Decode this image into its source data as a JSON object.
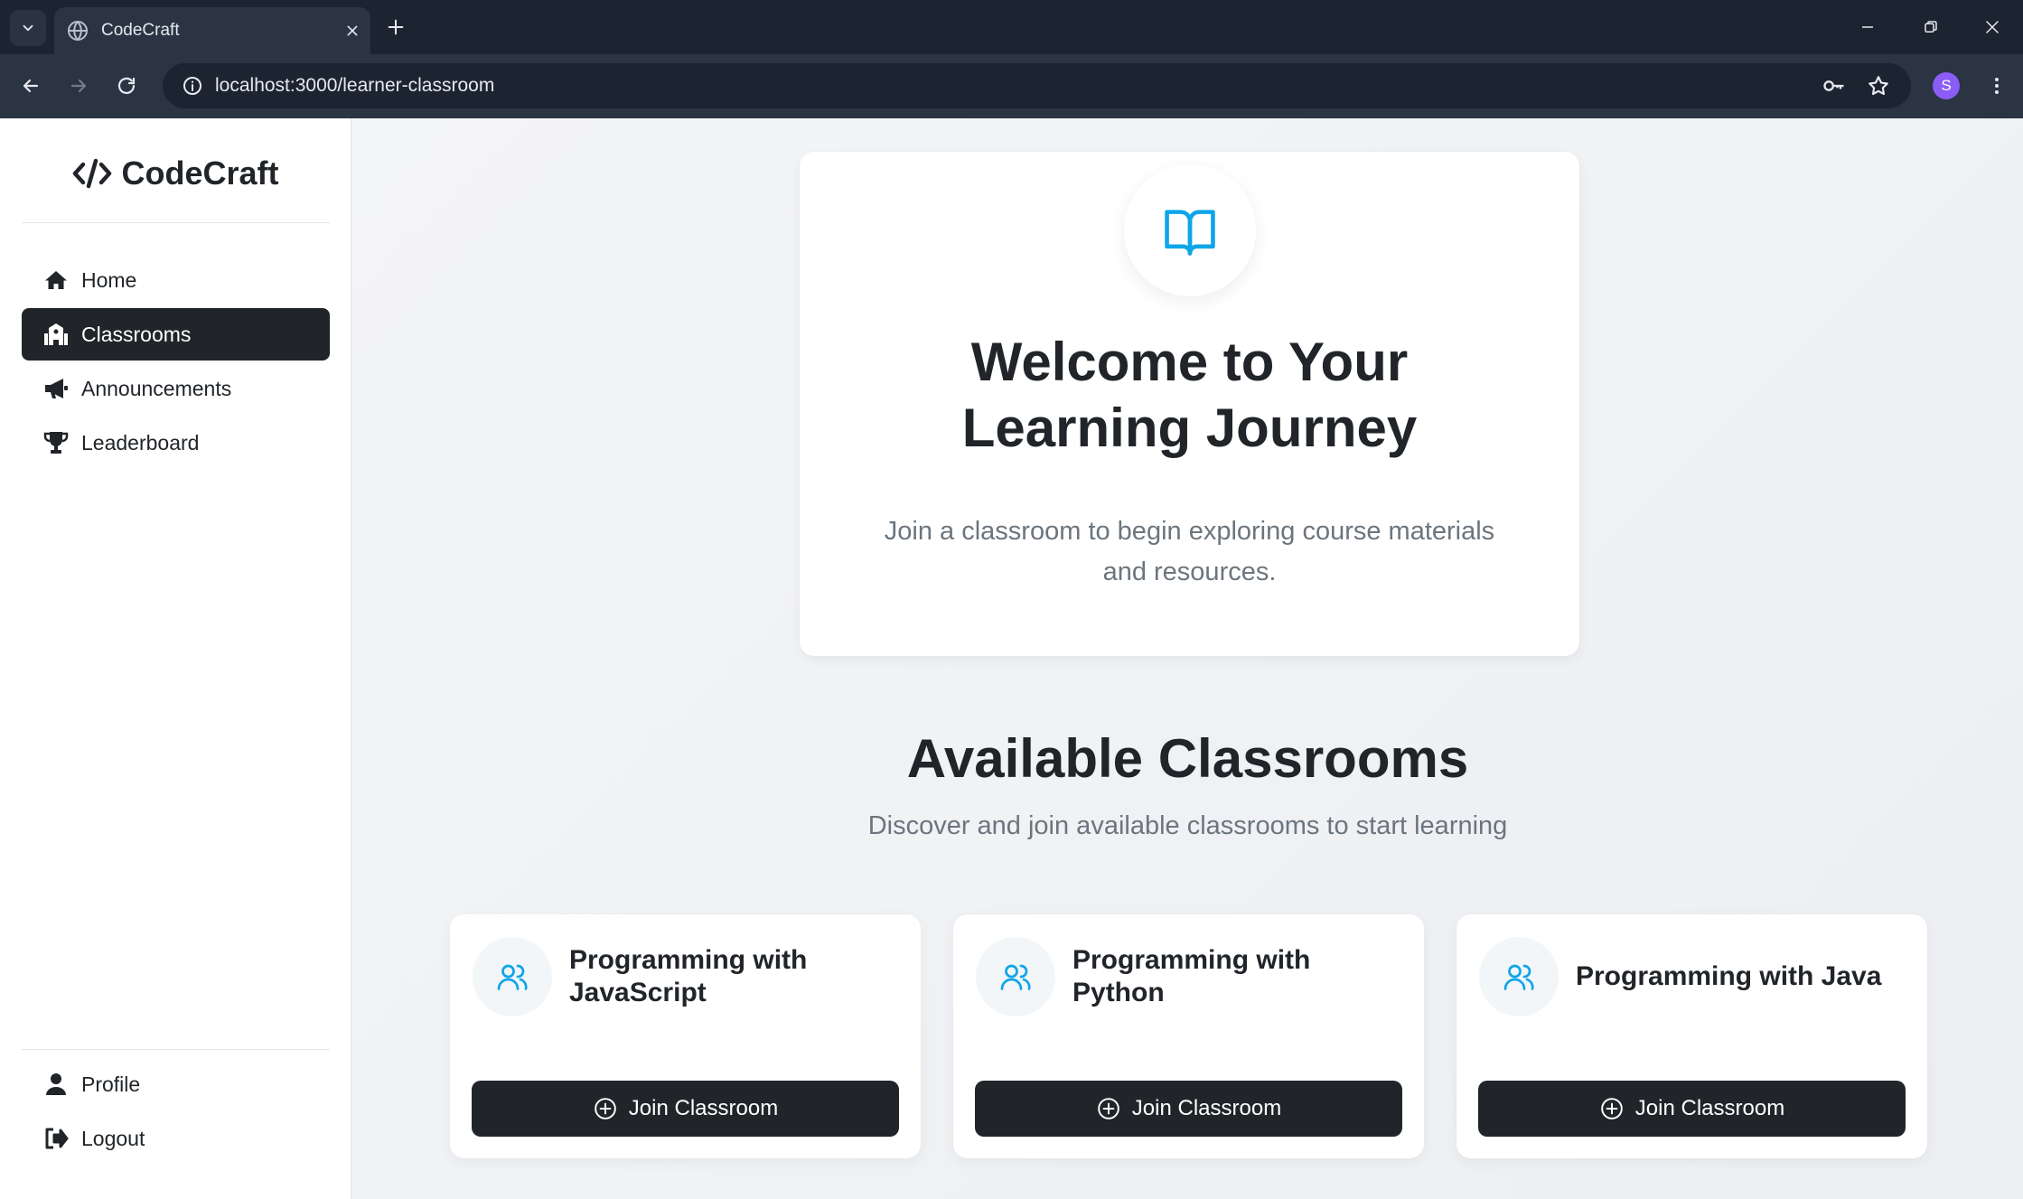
{
  "browser": {
    "tab_title": "CodeCraft",
    "url": "localhost:3000/learner-classroom",
    "profile_initial": "S"
  },
  "sidebar": {
    "brand": "CodeCraft",
    "items": [
      {
        "label": "Home",
        "icon": "home-icon",
        "active": false
      },
      {
        "label": "Classrooms",
        "icon": "school-icon",
        "active": true
      },
      {
        "label": "Announcements",
        "icon": "megaphone-icon",
        "active": false
      },
      {
        "label": "Leaderboard",
        "icon": "trophy-icon",
        "active": false
      }
    ],
    "bottom_items": [
      {
        "label": "Profile",
        "icon": "user-icon"
      },
      {
        "label": "Logout",
        "icon": "logout-icon"
      }
    ]
  },
  "hero": {
    "icon": "book-open-icon",
    "title_line1": "Welcome to Your",
    "title_line2": "Learning Journey",
    "subtitle_line1": "Join a classroom to begin exploring course materials",
    "subtitle_line2": "and resources."
  },
  "classrooms_section": {
    "title": "Available Classrooms",
    "subtitle": "Discover and join available classrooms to start learning",
    "cards": [
      {
        "title": "Programming with JavaScript",
        "button": "Join Classroom"
      },
      {
        "title": "Programming with Python",
        "button": "Join Classroom"
      },
      {
        "title": "Programming with Java",
        "button": "Join Classroom"
      }
    ]
  },
  "colors": {
    "accent": "#0ea5e9",
    "dark": "#212529",
    "muted": "#6c757d",
    "profile": "#8b5cf6"
  }
}
